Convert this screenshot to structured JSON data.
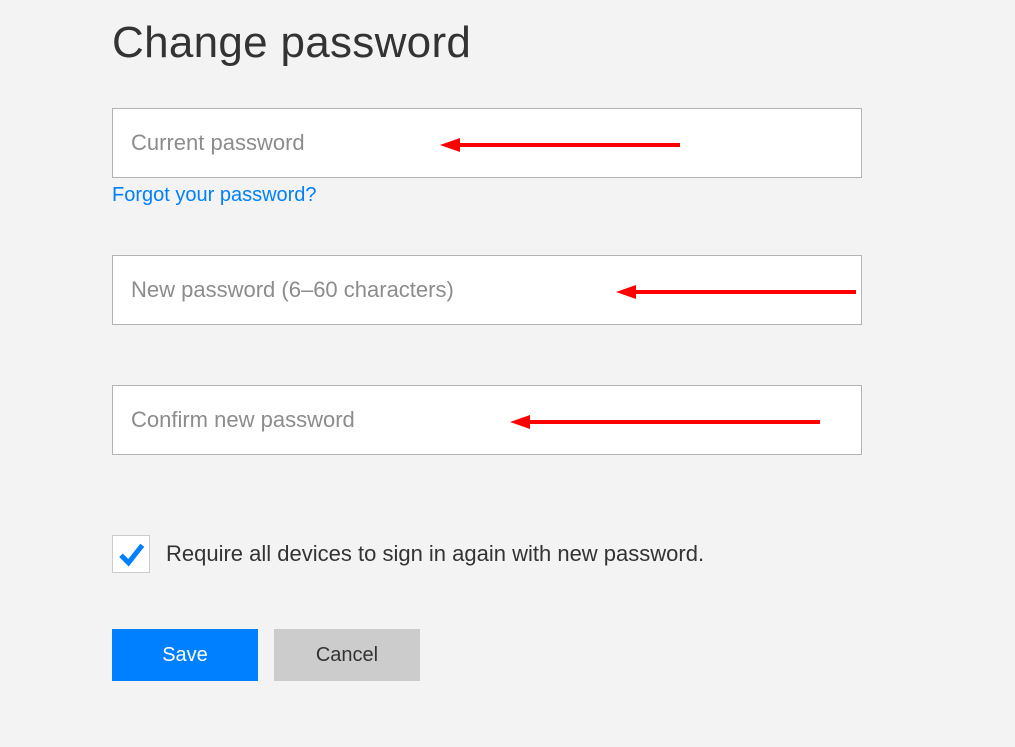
{
  "page_title": "Change password",
  "fields": {
    "current": {
      "placeholder": "Current password",
      "value": ""
    },
    "new": {
      "placeholder": "New password (6–60 characters)",
      "value": ""
    },
    "confirm": {
      "placeholder": "Confirm new password",
      "value": ""
    }
  },
  "links": {
    "forgot": "Forgot your password?"
  },
  "checkbox": {
    "checked": true,
    "label": "Require all devices to sign in again with new password."
  },
  "buttons": {
    "save": "Save",
    "cancel": "Cancel"
  },
  "annotations": {
    "arrow_color": "#ff0000"
  }
}
